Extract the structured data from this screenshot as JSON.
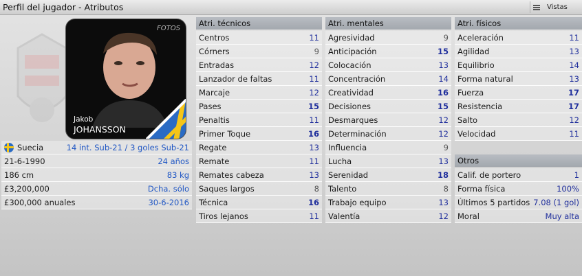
{
  "window": {
    "title": "Perfil del jugador - Atributos",
    "views_label": "Vistas"
  },
  "player": {
    "first_name": "Jakob",
    "last_name": "JOHANSSON",
    "photo_watermark": "FOTOS"
  },
  "profile_rows": [
    {
      "label": "Suecia",
      "value": "14 int. Sub-21 / 3 goles Sub-21"
    },
    {
      "label": "21-6-1990",
      "value": "24 años"
    },
    {
      "label": "186 cm",
      "value": "83 kg"
    },
    {
      "label": "£3,200,000",
      "value": "Dcha. sólo"
    },
    {
      "label": "£300,000 anuales",
      "value": "30-6-2016"
    }
  ],
  "technical": {
    "header": "Atri. técnicos",
    "rows": [
      {
        "label": "Centros",
        "value": "11"
      },
      {
        "label": "Córners",
        "value": "9"
      },
      {
        "label": "Entradas",
        "value": "12"
      },
      {
        "label": "Lanzador de faltas",
        "value": "11"
      },
      {
        "label": "Marcaje",
        "value": "12"
      },
      {
        "label": "Pases",
        "value": "15"
      },
      {
        "label": "Penaltis",
        "value": "11"
      },
      {
        "label": "Primer Toque",
        "value": "16"
      },
      {
        "label": "Regate",
        "value": "13"
      },
      {
        "label": "Remate",
        "value": "11"
      },
      {
        "label": "Remates cabeza",
        "value": "13"
      },
      {
        "label": "Saques largos",
        "value": "8"
      },
      {
        "label": "Técnica",
        "value": "16"
      },
      {
        "label": "Tiros lejanos",
        "value": "11"
      }
    ]
  },
  "mental": {
    "header": "Atri. mentales",
    "rows": [
      {
        "label": "Agresividad",
        "value": "9"
      },
      {
        "label": "Anticipación",
        "value": "15"
      },
      {
        "label": "Colocación",
        "value": "13"
      },
      {
        "label": "Concentración",
        "value": "14"
      },
      {
        "label": "Creatividad",
        "value": "16"
      },
      {
        "label": "Decisiones",
        "value": "15"
      },
      {
        "label": "Desmarques",
        "value": "12"
      },
      {
        "label": "Determinación",
        "value": "12"
      },
      {
        "label": "Influencia",
        "value": "9"
      },
      {
        "label": "Lucha",
        "value": "13"
      },
      {
        "label": "Serenidad",
        "value": "18"
      },
      {
        "label": "Talento",
        "value": "8"
      },
      {
        "label": "Trabajo equipo",
        "value": "13"
      },
      {
        "label": "Valentía",
        "value": "12"
      }
    ]
  },
  "physical": {
    "header": "Atri. físicos",
    "rows": [
      {
        "label": "Aceleración",
        "value": "11"
      },
      {
        "label": "Agilidad",
        "value": "13"
      },
      {
        "label": "Equilibrio",
        "value": "14"
      },
      {
        "label": "Forma natural",
        "value": "13"
      },
      {
        "label": "Fuerza",
        "value": "17"
      },
      {
        "label": "Resistencia",
        "value": "17"
      },
      {
        "label": "Salto",
        "value": "12"
      },
      {
        "label": "Velocidad",
        "value": "11"
      }
    ]
  },
  "other": {
    "header": "Otros",
    "rows": [
      {
        "label": "Calif. de portero",
        "value": "1"
      },
      {
        "label": "Forma física",
        "value": "100%"
      },
      {
        "label": "Últimos 5 partidos",
        "value": "7.08 (1 gol)"
      },
      {
        "label": "Moral",
        "value": "Muy alta"
      }
    ]
  },
  "colors": {
    "value_blue": "#1f2e9c",
    "link_blue": "#1f56c4",
    "header_grey": "#a3a8ae",
    "flag_blue": "#2a6bc4",
    "flag_yellow": "#f5c518"
  }
}
